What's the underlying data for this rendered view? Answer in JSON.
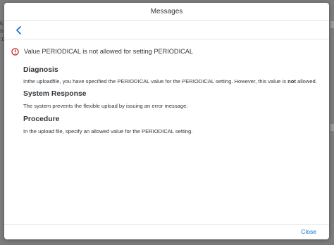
{
  "dialog": {
    "title": "Messages",
    "close_label": "Close"
  },
  "message": {
    "title": "Value PERIODICAL is not allowed for setting PERIODICAL",
    "sections": [
      {
        "heading": "Diagnosis",
        "text_before": "Inthe uploadfile, you have specified the PERIODICAL value for the PERIODICAL setting. However, this value is ",
        "text_bold": "not",
        "text_after": " allowed."
      },
      {
        "heading": "System Response",
        "text": "The system prevents the flexible upload by issuing an error message."
      },
      {
        "heading": "Procedure",
        "text": "In the upload file, specify an allowed value for the PERIODICAL setting."
      }
    ]
  },
  "background": {
    "edge_left_text": "k\nn\n:c"
  },
  "colors": {
    "accent": "#0a6ed1",
    "error": "#bb0000",
    "text": "#32363a"
  },
  "icons": {
    "back": "back-chevron-icon",
    "error": "error-circle-icon"
  }
}
